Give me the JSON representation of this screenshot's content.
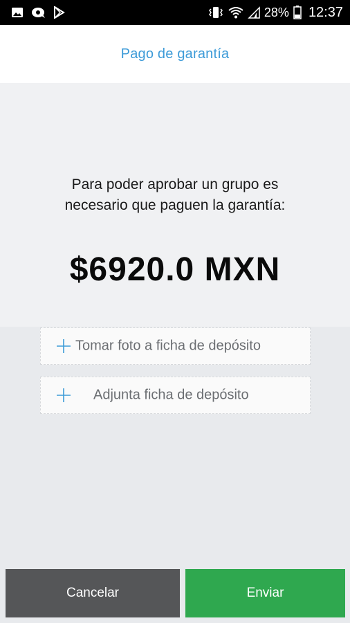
{
  "status_bar": {
    "icons_left": [
      "gallery-icon",
      "chat-icon",
      "play-store-icon"
    ],
    "icons_right": [
      "vibrate-icon",
      "wifi-icon",
      "signal-icon",
      "battery-icon"
    ],
    "battery": "28%",
    "time": "12:37"
  },
  "header": {
    "title": "Pago de garantía"
  },
  "main": {
    "message_line1": "Para poder aprobar un grupo es",
    "message_line2": "necesario que paguen la garantía:",
    "amount": "$6920.0 MXN",
    "take_photo_label": "Tomar foto a ficha de depósito",
    "attach_label": "Adjunta ficha de depósito"
  },
  "buttons": {
    "cancel": "Cancelar",
    "send": "Enviar"
  },
  "colors": {
    "accent": "#3d9bd8",
    "send": "#2fa84f",
    "cancel": "#555658"
  }
}
